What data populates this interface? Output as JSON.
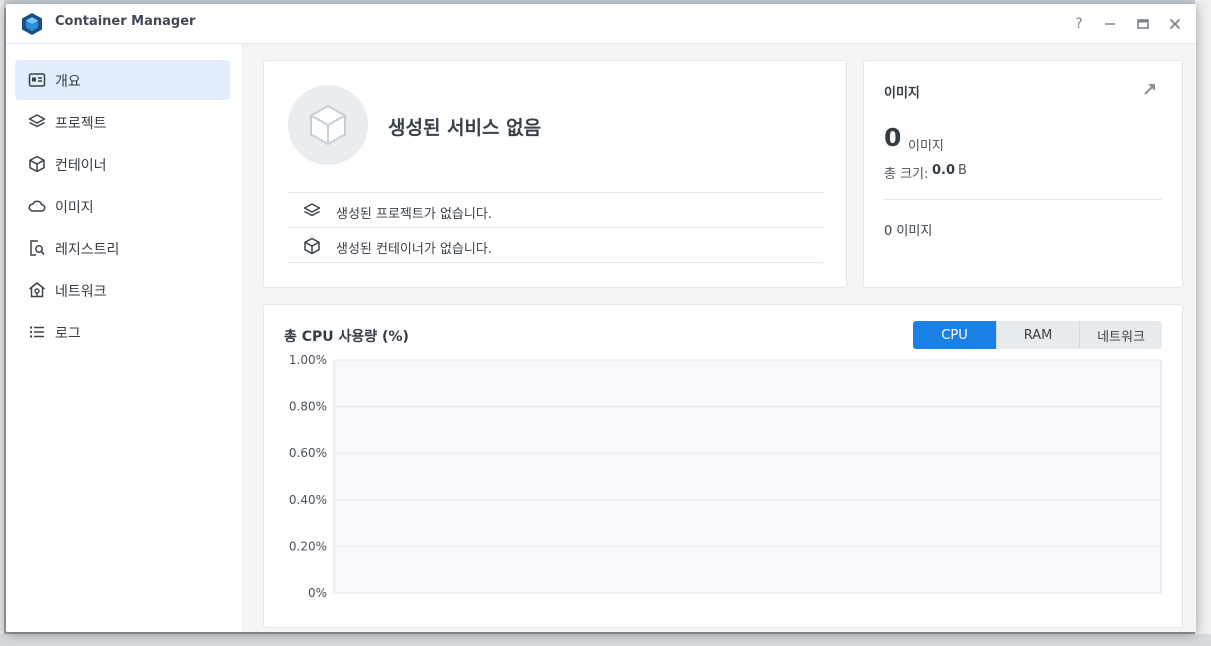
{
  "window": {
    "title": "Container Manager",
    "controls": {
      "help": "?",
      "minimize": "—",
      "maximize": "▭",
      "close": "✕"
    }
  },
  "sidebar": {
    "items": [
      {
        "label": "개요",
        "icon": "overview-icon",
        "active": true
      },
      {
        "label": "프로젝트",
        "icon": "layers-icon"
      },
      {
        "label": "컨테이너",
        "icon": "cube-icon"
      },
      {
        "label": "이미지",
        "icon": "cloud-icon"
      },
      {
        "label": "레지스트리",
        "icon": "registry-search-icon"
      },
      {
        "label": "네트워크",
        "icon": "network-house-icon"
      },
      {
        "label": "로그",
        "icon": "list-icon"
      }
    ]
  },
  "services": {
    "title": "생성된 서비스 없음",
    "rows": [
      {
        "text": "생성된 프로젝트가 없습니다.",
        "icon": "layers-icon"
      },
      {
        "text": "생성된 컨테이너가 없습니다.",
        "icon": "cube-icon"
      }
    ]
  },
  "images": {
    "title": "이미지",
    "count": "0",
    "count_unit": "이미지",
    "size_label": "총 크기:",
    "size_value": "0.0",
    "size_unit": "B",
    "summary": "0 이미지"
  },
  "cpu_panel": {
    "title": "총 CPU 사용량 (%)",
    "tabs": [
      "CPU",
      "RAM",
      "네트워크"
    ],
    "active_tab": "CPU"
  },
  "colors": {
    "accent": "#1a80e6",
    "active_nav_bg": "#e3eefc",
    "chart_bg": "#f7f9fc"
  },
  "chart_data": {
    "type": "line",
    "title": "총 CPU 사용량 (%)",
    "xlabel": "",
    "ylabel": "",
    "ylim": [
      0,
      1
    ],
    "yticks": [
      "1.00%",
      "0.80%",
      "0.60%",
      "0.40%",
      "0.20%",
      "0%"
    ],
    "ytick_values": [
      1.0,
      0.8,
      0.6,
      0.4,
      0.2,
      0
    ],
    "series": [],
    "grid": true
  }
}
